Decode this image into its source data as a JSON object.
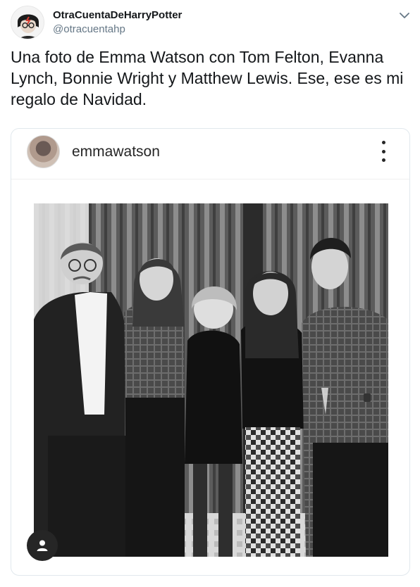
{
  "author": {
    "display_name": "OtraCuentaDeHarryPotter",
    "handle": "@otracuentahp"
  },
  "tweet": {
    "text": "Una foto de Emma Watson con Tom Felton, Evanna Lynch, Bonnie Wright y Matthew Lewis. Ese, ese es mi regalo de Navidad."
  },
  "instagram_embed": {
    "username": "emmawatson",
    "photo_style": "black-and-white group portrait of five people in front of striped curtains"
  },
  "icons": {
    "caret": "chevron-down-icon",
    "more": "more-vertical-icon",
    "user_tag": "user-icon"
  },
  "colors": {
    "text_primary": "#14171a",
    "text_secondary": "#657786",
    "border": "#e1e8ed",
    "ig_text": "#262626"
  }
}
